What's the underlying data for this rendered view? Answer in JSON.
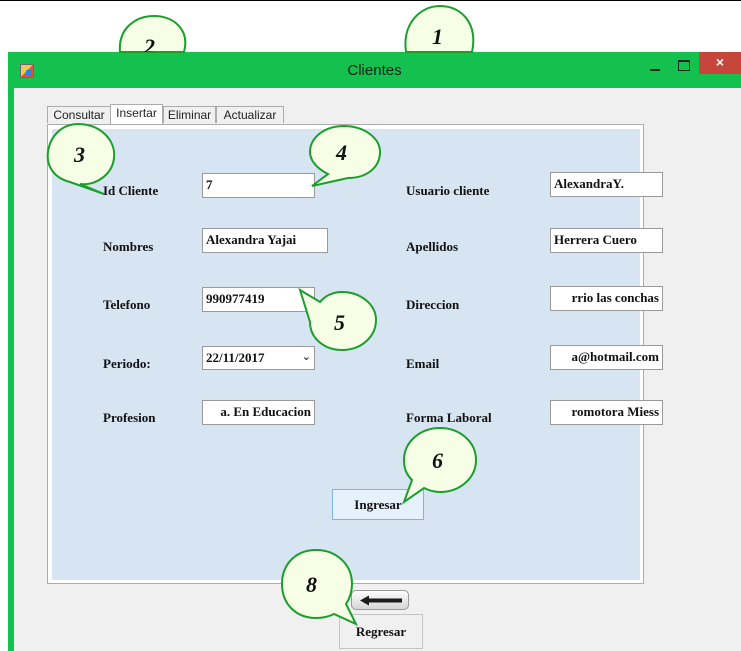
{
  "window": {
    "title": "Clientes",
    "close_glyph": "×",
    "min_icon": "minimize-icon",
    "max_icon": "maximize-icon"
  },
  "tabs": [
    {
      "label": "Consultar",
      "active": false
    },
    {
      "label": "Insertar",
      "active": true
    },
    {
      "label": "Eliminar",
      "active": false
    },
    {
      "label": "Actualizar",
      "active": false
    }
  ],
  "form": {
    "id_cliente": {
      "label": "Id Cliente",
      "value": "7"
    },
    "usuario_cliente": {
      "label": "Usuario cliente",
      "value": "AlexandraY."
    },
    "nombres": {
      "label": "Nombres",
      "value": "Alexandra Yajai"
    },
    "apellidos": {
      "label": "Apellidos",
      "value": "Herrera Cuero"
    },
    "telefono": {
      "label": "Telefono",
      "value": "990977419"
    },
    "direccion": {
      "label": "Direccion",
      "value": "rrio las conchas"
    },
    "periodo": {
      "label": "Periodo:",
      "value": "22/11/2017"
    },
    "email": {
      "label": "Email",
      "value": "a@hotmail.com"
    },
    "profesion": {
      "label": "Profesion",
      "value": "a. En Educacion"
    },
    "forma_laboral": {
      "label": "Forma Laboral",
      "value": "romotora Miess"
    }
  },
  "buttons": {
    "ingresar": "Ingresar",
    "regresar": "Regresar",
    "back_icon": "arrow-left-icon"
  },
  "callouts": [
    "1",
    "2",
    "3",
    "4",
    "5",
    "6",
    "8"
  ],
  "colors": {
    "window_frame": "#14c14f",
    "close_button": "#c7463c",
    "panel_background": "#d7e4f1",
    "callout_fill": "#f6ffe6",
    "callout_stroke": "#1a9e2c"
  }
}
